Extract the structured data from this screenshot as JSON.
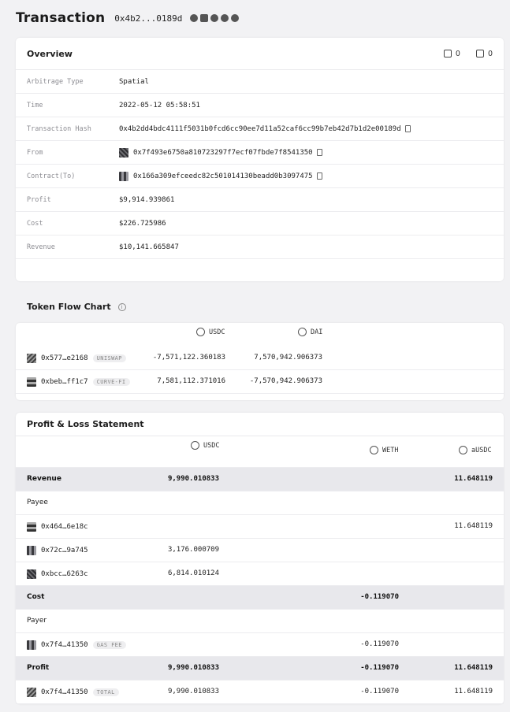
{
  "header": {
    "title": "Transaction",
    "hash_short": "0x4b2...0189d"
  },
  "overview": {
    "title": "Overview",
    "likes": "0",
    "comments": "0",
    "rows": [
      {
        "label": "Arbitrage Type",
        "value": "Spatial"
      },
      {
        "label": "Time",
        "value": "2022-05-12 05:58:51"
      },
      {
        "label": "Transaction Hash",
        "value": "0x4b2dd4bdc4111f5031b0fcd6cc90ee7d11a52caf6cc99b7eb42d7b1d2e00189d"
      },
      {
        "label": "From",
        "value": "0x7f493e6750a810723297f7ecf07fbde7f8541350"
      },
      {
        "label": "Contract(To)",
        "value": "0x166a309efceedc82c501014130beadd0b3097475"
      },
      {
        "label": "Profit",
        "value": "$9,914.939861"
      },
      {
        "label": "Cost",
        "value": "$226.725986"
      },
      {
        "label": "Revenue",
        "value": "$10,141.665847"
      }
    ]
  },
  "token_flow": {
    "title": "Token Flow Chart",
    "coins": [
      "USDC",
      "DAI"
    ],
    "rows": [
      {
        "addr": "0x577…e2168",
        "badge": "UNISWAP",
        "v1": "-7,571,122.360183",
        "v2": "7,570,942.906373"
      },
      {
        "addr": "0xbeb…ff1c7",
        "badge": "CURVE-FI",
        "v1": "7,581,112.371016",
        "v2": "-7,570,942.906373"
      }
    ]
  },
  "pl": {
    "title": "Profit & Loss Statement",
    "coins": [
      "USDC",
      "WETH",
      "aUSDC"
    ],
    "rows": [
      {
        "type": "section",
        "label": "Revenue",
        "c1": "9,990.010833",
        "c2": "",
        "c3": "11.648119"
      },
      {
        "type": "plain",
        "label": "Payee",
        "c1": "",
        "c2": "",
        "c3": ""
      },
      {
        "type": "addr",
        "label": "0x464…6e18c",
        "badge": "",
        "c1": "",
        "c2": "",
        "c3": "11.648119"
      },
      {
        "type": "addr",
        "label": "0x72c…9a745",
        "badge": "",
        "c1": "3,176.000709",
        "c2": "",
        "c3": ""
      },
      {
        "type": "addr",
        "label": "0xbcc…6263c",
        "badge": "",
        "c1": "6,814.010124",
        "c2": "",
        "c3": ""
      },
      {
        "type": "section",
        "label": "Cost",
        "c1": "",
        "c2": "-0.119070",
        "c3": ""
      },
      {
        "type": "plain",
        "label": "Payer",
        "c1": "",
        "c2": "",
        "c3": ""
      },
      {
        "type": "addr",
        "label": "0x7f4…41350",
        "badge": "GAS FEE",
        "c1": "",
        "c2": "-0.119070",
        "c3": ""
      },
      {
        "type": "section",
        "label": "Profit",
        "c1": "9,990.010833",
        "c2": "-0.119070",
        "c3": "11.648119"
      },
      {
        "type": "addr",
        "label": "0x7f4…41350",
        "badge": "TOTAL",
        "c1": "9,990.010833",
        "c2": "-0.119070",
        "c3": "11.648119"
      }
    ]
  }
}
